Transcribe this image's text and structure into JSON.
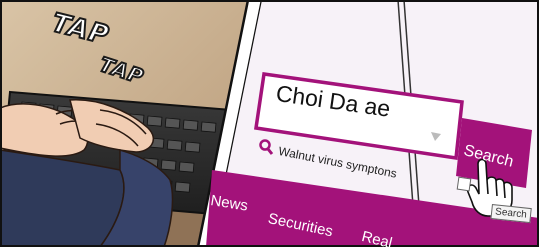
{
  "sound_effects": [
    "TAP",
    "TAP"
  ],
  "search": {
    "query": "Choi Da ae",
    "suggestion": "Walnut virus symptons",
    "button_label": "Search",
    "tooltip": "Search"
  },
  "nav": {
    "items": [
      "News",
      "Securities",
      "Real"
    ]
  },
  "colors": {
    "brand": "#a3127a",
    "brand_light": "#c43c97",
    "page_bg": "#f7f2f8"
  },
  "icons": [
    "magnifier-icon",
    "chevron-down-icon",
    "hand-cursor-icon"
  ]
}
